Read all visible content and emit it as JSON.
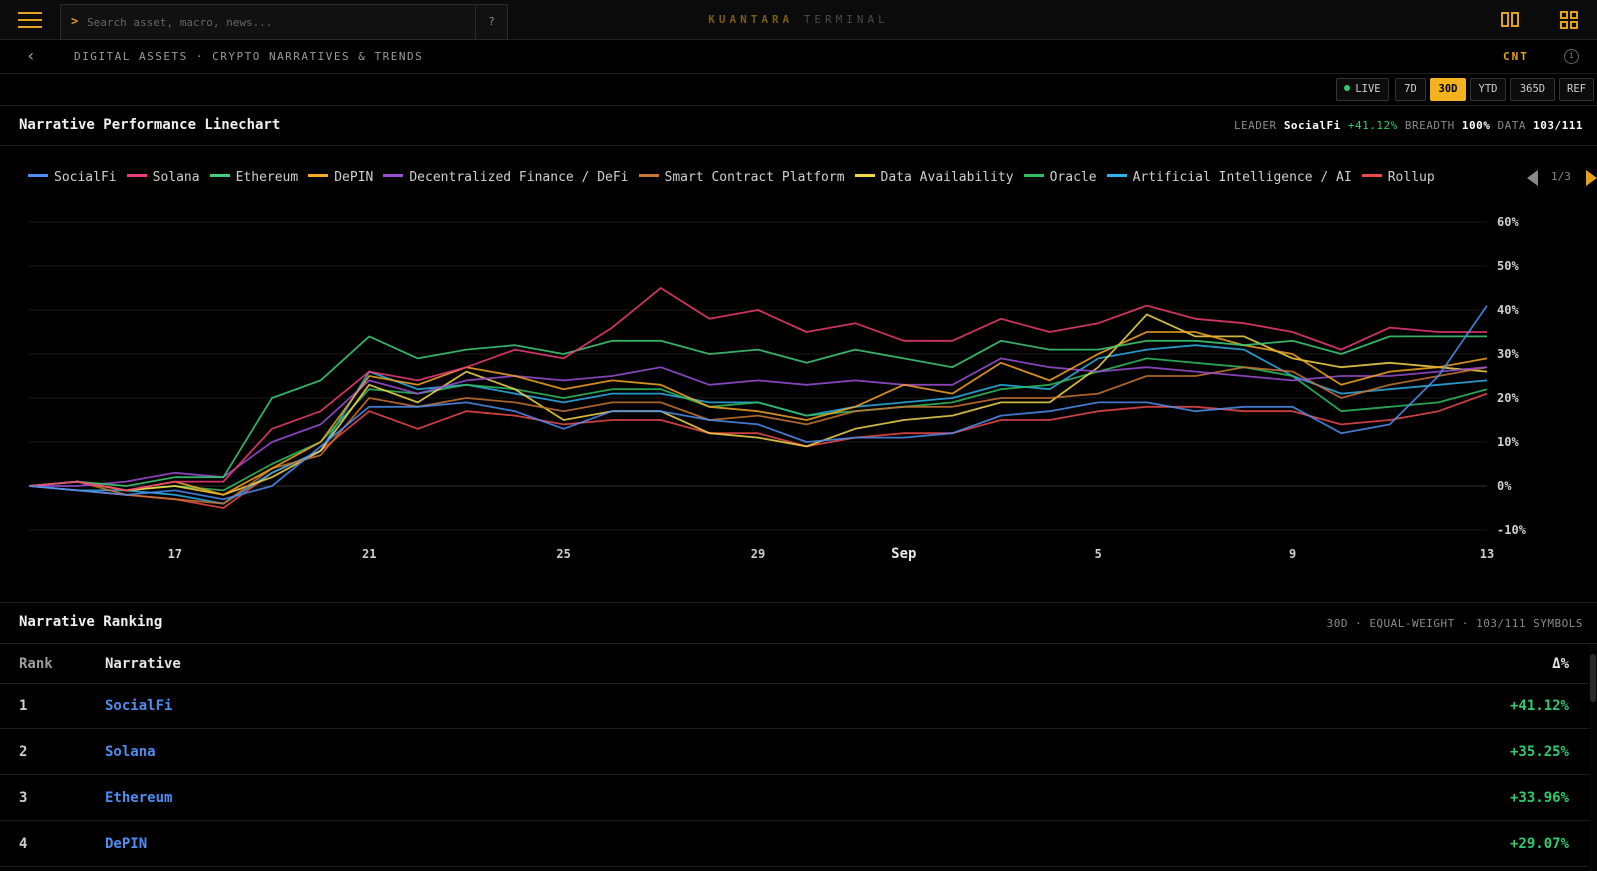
{
  "header": {
    "search_prompt": ">",
    "search_placeholder": "Search asset, macro, news...",
    "help_label": "?",
    "brand_primary": "KUANTARA",
    "brand_secondary": "TERMINAL",
    "accent_color": "#e3a21a"
  },
  "breadcrumb": {
    "path": "DIGITAL ASSETS · CRYPTO NARRATIVES & TRENDS",
    "back_label": "‹",
    "cnt_label": "CNT",
    "info_label": "i"
  },
  "ranges": {
    "live": "LIVE",
    "d7": "7D",
    "d30": "30D",
    "ytd": "YTD",
    "d365": "365D",
    "ref": "REF",
    "active": "30D"
  },
  "performance": {
    "title": "Narrative Performance Linechart",
    "leader_label": "LEADER",
    "leader_value": "SocialFi",
    "leader_change": "+41.12%",
    "breadth_label": "BREADTH",
    "breadth_value": "100%",
    "data_label": "DATA",
    "data_value": "103/111",
    "legend_page": "1/3"
  },
  "chart_data": {
    "type": "line",
    "x": [
      "Aug 14",
      "Aug 15",
      "Aug 16",
      "Aug 17",
      "Aug 18",
      "Aug 19",
      "Aug 20",
      "Aug 21",
      "Aug 22",
      "Aug 23",
      "Aug 24",
      "Aug 25",
      "Aug 26",
      "Aug 27",
      "Aug 28",
      "Aug 29",
      "Aug 30",
      "Aug 31",
      "Sep 1",
      "Sep 2",
      "Sep 3",
      "Sep 4",
      "Sep 5",
      "Sep 6",
      "Sep 7",
      "Sep 8",
      "Sep 9",
      "Sep 10",
      "Sep 11",
      "Sep 12",
      "Sep 13"
    ],
    "xticks": [
      {
        "label": "17",
        "index": 3
      },
      {
        "label": "21",
        "index": 7
      },
      {
        "label": "25",
        "index": 11
      },
      {
        "label": "29",
        "index": 15
      },
      {
        "label": "Sep",
        "index": 18
      },
      {
        "label": "5",
        "index": 22
      },
      {
        "label": "9",
        "index": 26
      },
      {
        "label": "13",
        "index": 30
      }
    ],
    "yticks": [
      "60%",
      "50%",
      "40%",
      "30%",
      "20%",
      "10%",
      "0%",
      "-10%"
    ],
    "ylim": [
      -10,
      60
    ],
    "grid": true,
    "series": [
      {
        "name": "SocialFi",
        "color": "#4d8ef0",
        "values": [
          0,
          -1,
          -2,
          -1,
          -3,
          0,
          9,
          18,
          18,
          19,
          17,
          13,
          17,
          17,
          15,
          14,
          10,
          11,
          11,
          12,
          16,
          17,
          19,
          19,
          17,
          18,
          18,
          12,
          14,
          25,
          41
        ]
      },
      {
        "name": "Solana",
        "color": "#f03c78",
        "values": [
          0,
          1,
          -1,
          1,
          1,
          13,
          17,
          26,
          24,
          27,
          31,
          29,
          36,
          45,
          38,
          40,
          35,
          37,
          33,
          33,
          38,
          35,
          37,
          41,
          38,
          37,
          35,
          31,
          36,
          35,
          35
        ]
      },
      {
        "name": "Ethereum",
        "color": "#3ecf78",
        "values": [
          0,
          1,
          0,
          2,
          2,
          20,
          24,
          34,
          29,
          31,
          32,
          30,
          33,
          33,
          30,
          31,
          28,
          31,
          29,
          27,
          33,
          31,
          31,
          33,
          33,
          32,
          33,
          30,
          34,
          34,
          34
        ]
      },
      {
        "name": "DePIN",
        "color": "#f5a623",
        "values": [
          0,
          1,
          -1,
          1,
          -2,
          4,
          10,
          25,
          23,
          27,
          25,
          22,
          24,
          23,
          18,
          17,
          15,
          18,
          23,
          21,
          28,
          24,
          30,
          35,
          35,
          32,
          30,
          23,
          26,
          27,
          29
        ]
      },
      {
        "name": "Decentralized Finance / DeFi",
        "color": "#9b4fd6",
        "values": [
          0,
          0,
          1,
          3,
          2,
          10,
          14,
          24,
          21,
          24,
          25,
          24,
          25,
          27,
          23,
          24,
          23,
          24,
          23,
          23,
          29,
          27,
          26,
          27,
          26,
          25,
          24,
          25,
          25,
          26,
          27
        ]
      },
      {
        "name": "Smart Contract Platform",
        "color": "#c87433",
        "values": [
          0,
          1,
          -2,
          -3,
          -4,
          4,
          7,
          20,
          18,
          20,
          19,
          17,
          19,
          19,
          15,
          16,
          14,
          17,
          18,
          18,
          20,
          20,
          21,
          25,
          25,
          27,
          26,
          20,
          23,
          25,
          27
        ]
      },
      {
        "name": "Data Availability",
        "color": "#f5d84a",
        "values": [
          0,
          1,
          -1,
          0,
          -2,
          2,
          8,
          23,
          19,
          26,
          22,
          15,
          17,
          17,
          12,
          11,
          9,
          13,
          15,
          16,
          19,
          19,
          27,
          39,
          34,
          34,
          29,
          27,
          28,
          27,
          26
        ]
      },
      {
        "name": "Oracle",
        "color": "#2fbf5f",
        "values": [
          0,
          1,
          -1,
          0,
          -1,
          5,
          10,
          22,
          21,
          23,
          22,
          20,
          22,
          22,
          18,
          19,
          16,
          17,
          18,
          19,
          22,
          23,
          26,
          29,
          28,
          27,
          25,
          17,
          18,
          19,
          22
        ]
      },
      {
        "name": "Artificial Intelligence / AI",
        "color": "#2bb3ea",
        "values": [
          0,
          -1,
          -1,
          -2,
          -4,
          3,
          8,
          26,
          22,
          23,
          21,
          19,
          21,
          21,
          19,
          19,
          16,
          18,
          19,
          20,
          23,
          22,
          29,
          31,
          32,
          31,
          25,
          21,
          22,
          23,
          24
        ]
      },
      {
        "name": "Rollup",
        "color": "#ef4a4a",
        "values": [
          0,
          -1,
          -2,
          -3,
          -5,
          3,
          8,
          17,
          13,
          17,
          16,
          14,
          15,
          15,
          12,
          12,
          9,
          11,
          12,
          12,
          15,
          15,
          17,
          18,
          18,
          17,
          17,
          14,
          15,
          17,
          21
        ]
      }
    ]
  },
  "ranking": {
    "title": "Narrative Ranking",
    "meta": "30D · EQUAL-WEIGHT · 103/111 SYMBOLS",
    "col_rank": "Rank",
    "col_narrative": "Narrative",
    "col_delta": "Δ%",
    "rows": [
      {
        "rank": "1",
        "name": "SocialFi",
        "delta": "+41.12%"
      },
      {
        "rank": "2",
        "name": "Solana",
        "delta": "+35.25%"
      },
      {
        "rank": "3",
        "name": "Ethereum",
        "delta": "+33.96%"
      },
      {
        "rank": "4",
        "name": "DePIN",
        "delta": "+29.07%"
      }
    ]
  }
}
